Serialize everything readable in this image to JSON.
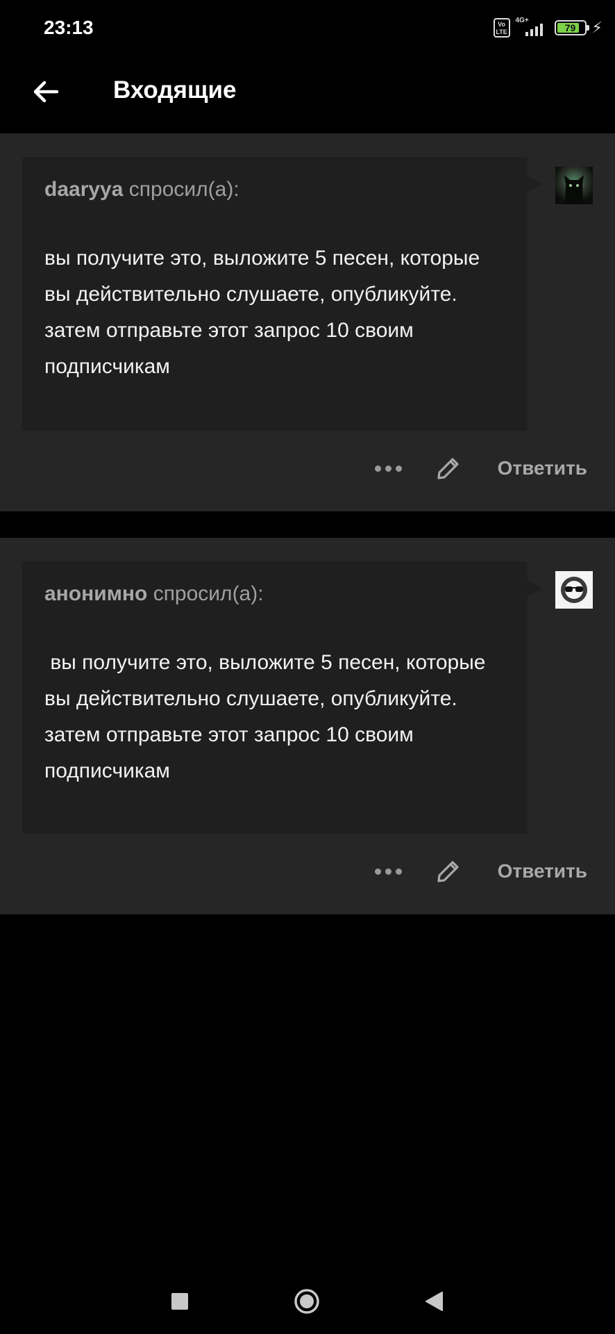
{
  "status_bar": {
    "time": "23:13",
    "volte": "Vo LTE",
    "network": "4G+",
    "battery": "79",
    "battery_fraction": 0.79,
    "battery_color": "#7bd14a"
  },
  "header": {
    "title": "Входящие",
    "back_icon": "arrow-left-icon"
  },
  "messages": [
    {
      "asker": "daaryya",
      "asked_label": "спросил(а):",
      "question": "вы получите это, выложите 5 песен, которые вы действительно слушаете, опубликуйте. затем отправьте этот запрос 10 своим подписчикам",
      "avatar": "cat-avatar",
      "more_icon": "more-horizontal-icon",
      "edit_icon": "pencil-icon",
      "reply_label": "Ответить"
    },
    {
      "asker": "анонимно",
      "asked_label": "спросил(а):",
      "question": " вы получите это, выложите 5 песен, которые вы действительно слушаете, опубликуйте. затем отправьте этот запрос 10 своим подписчикам",
      "avatar": "anonymous-sunglasses-avatar",
      "more_icon": "more-horizontal-icon",
      "edit_icon": "pencil-icon",
      "reply_label": "Ответить"
    }
  ],
  "navigation_bar": {
    "recents_icon": "square-icon",
    "home_icon": "circle-icon",
    "back_icon": "triangle-back-icon"
  },
  "colors": {
    "background": "#000000",
    "card": "#262626",
    "bubble": "#1f1f1f",
    "muted_text": "#a0a0a0"
  }
}
